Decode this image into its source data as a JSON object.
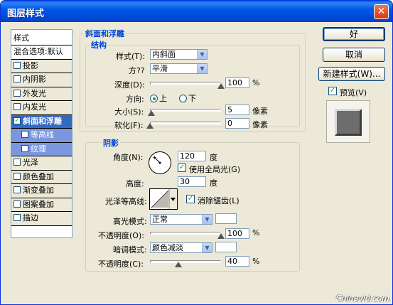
{
  "window": {
    "title": "图层样式",
    "close_glyph": "✕"
  },
  "style_list": {
    "header": "样式",
    "items": [
      {
        "label": "混合选项:默认",
        "checkbox": false
      },
      {
        "label": "投影",
        "checkbox": true,
        "checked": false
      },
      {
        "label": "内阴影",
        "checkbox": true,
        "checked": false
      },
      {
        "label": "外发光",
        "checkbox": true,
        "checked": false
      },
      {
        "label": "内发光",
        "checkbox": true,
        "checked": false
      },
      {
        "label": "斜面和浮雕",
        "checkbox": true,
        "checked": true,
        "selected": true
      },
      {
        "label": "等高线",
        "checkbox": true,
        "checked": false,
        "sub": true
      },
      {
        "label": "纹理",
        "checkbox": true,
        "checked": false,
        "sub": true
      },
      {
        "label": "光泽",
        "checkbox": true,
        "checked": false
      },
      {
        "label": "颜色叠加",
        "checkbox": true,
        "checked": false
      },
      {
        "label": "渐变叠加",
        "checkbox": true,
        "checked": false
      },
      {
        "label": "图案叠加",
        "checkbox": true,
        "checked": false
      },
      {
        "label": "描边",
        "checkbox": true,
        "checked": false
      }
    ]
  },
  "bevel": {
    "section_title": "斜面和浮雕",
    "structure_title": "结构",
    "style_label": "样式(T):",
    "style_value": "内斜面",
    "technique_label": "方??",
    "technique_value": "平滑",
    "depth_label": "深度(D):",
    "depth_value": "100",
    "depth_unit": "%",
    "depth_level": 1.0,
    "direction_label": "方向:",
    "direction_up": "上",
    "direction_down": "下",
    "direction_selected": "上",
    "size_label": "大小(S):",
    "size_value": "5",
    "size_unit": "像素",
    "size_level": 0.02,
    "soften_label": "软化(F):",
    "soften_value": "0",
    "soften_unit": "像素",
    "soften_level": 0.0
  },
  "shading": {
    "title": "阴影",
    "angle_label": "角度(N):",
    "angle_value": "120",
    "angle_unit": "度",
    "global_light_label": "使用全局光(G)",
    "global_light_checked": true,
    "altitude_label": "高度:",
    "altitude_value": "30",
    "altitude_unit": "度",
    "gloss_contour_label": "光泽等高线:",
    "antialias_label": "消除锯齿(L)",
    "antialias_checked": true,
    "highlight_mode_label": "高光模式:",
    "highlight_mode_value": "正常",
    "highlight_color": "#ffffff",
    "highlight_opacity_label": "不透明度(O):",
    "highlight_opacity_value": "100",
    "highlight_opacity_level": 1.0,
    "shadow_mode_label": "暗调模式:",
    "shadow_mode_value": "颜色减淡",
    "shadow_color": "#ffffff",
    "shadow_opacity_label": "不透明度(C):",
    "shadow_opacity_value": "40",
    "shadow_opacity_level": 0.4,
    "percent_unit": "%"
  },
  "buttons": {
    "ok": "好",
    "cancel": "取消",
    "new_style": "新建样式(W)...",
    "preview_label": "预览(V)",
    "preview_checked": true
  },
  "watermark": "Chinavid.com",
  "colors": {
    "title_bar": "#0058e6",
    "selected_row": "#316ac5",
    "sub_row": "#7a96df",
    "group_title": "#0046d5",
    "preview_swatch": "#6d6d6d"
  },
  "icons": {
    "dropdown": "chevron-down-icon",
    "check": "check-icon"
  }
}
